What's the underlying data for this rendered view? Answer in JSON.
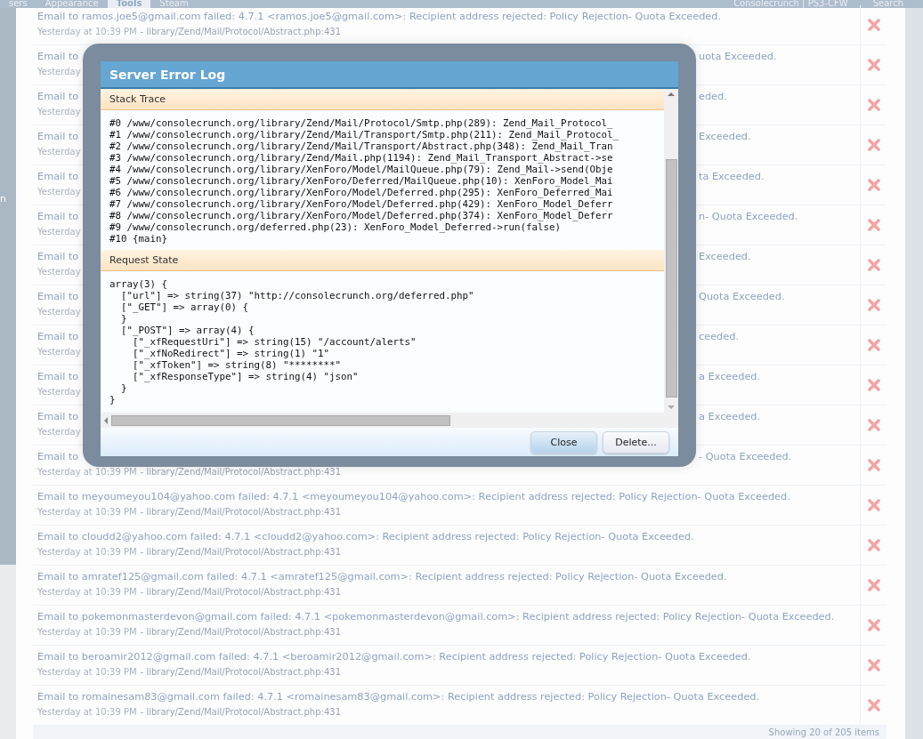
{
  "nav": {
    "tabs": [
      {
        "label": "sers",
        "selected": false
      },
      {
        "label": "Appearance",
        "selected": false
      },
      {
        "label": "Tools",
        "selected": true
      },
      {
        "label": "Steam",
        "selected": false
      }
    ],
    "links": [
      "Consolecrunch | PS3-CFW",
      "Search"
    ]
  },
  "sidebar": {
    "label": "n"
  },
  "rows": [
    {
      "kind": "full",
      "message": "Email to ramos.joe5@gmail.com failed: 4.7.1 <ramos.joe5@gmail.com>: Recipient address rejected: Policy Rejection- Quota Exceeded.",
      "time": "Yesterday at 10:39 PM",
      "source": "- library/Zend/Mail/Protocol/Abstract.php:431"
    },
    {
      "kind": "covered",
      "message_start": "Email to",
      "message_end": "uota Exceeded.",
      "time": "Yesterday"
    },
    {
      "kind": "covered",
      "message_start": "Email to",
      "message_end": "eded.",
      "time": "Yesterday"
    },
    {
      "kind": "covered",
      "message_start": "Email to",
      "message_end": "Exceeded.",
      "time": "Yesterday"
    },
    {
      "kind": "covered",
      "message_start": "Email to",
      "message_end": "ta Exceeded.",
      "time": "Yesterday"
    },
    {
      "kind": "covered",
      "message_start": "Email to",
      "message_end": "n- Quota Exceeded.",
      "time": "Yesterday"
    },
    {
      "kind": "covered",
      "message_start": "Email to",
      "message_end": "Exceeded.",
      "time": "Yesterday"
    },
    {
      "kind": "covered",
      "message_start": "Email to",
      "message_end": "Quota Exceeded.",
      "time": "Yesterday"
    },
    {
      "kind": "covered",
      "message_start": "Email to",
      "message_end": "ceeded.",
      "time": "Yesterday"
    },
    {
      "kind": "covered",
      "message_start": "Email to",
      "message_end": "a Exceeded.",
      "time": "Yesterday"
    },
    {
      "kind": "covered",
      "message_start": "Email to",
      "message_end": "a Exceeded.",
      "time": "Yesterday"
    },
    {
      "kind": "covered",
      "message_start": "Email to",
      "message_end": "- Quota Exceeded.",
      "time": "Yesterday at 10:39 PM",
      "source": "- library/Zend/Mail/Protocol/Abstract.php:431"
    },
    {
      "kind": "full",
      "message": "Email to meyoumeyou104@yahoo.com failed: 4.7.1 <meyoumeyou104@yahoo.com>: Recipient address rejected: Policy Rejection- Quota Exceeded.",
      "time": "Yesterday at 10:39 PM",
      "source": "- library/Zend/Mail/Protocol/Abstract.php:431"
    },
    {
      "kind": "full",
      "message": "Email to cloudd2@yahoo.com failed: 4.7.1 <cloudd2@yahoo.com>: Recipient address rejected: Policy Rejection- Quota Exceeded.",
      "time": "Yesterday at 10:39 PM",
      "source": "- library/Zend/Mail/Protocol/Abstract.php:431"
    },
    {
      "kind": "full",
      "message": "Email to amratef125@gmail.com failed: 4.7.1 <amratef125@gmail.com>: Recipient address rejected: Policy Rejection- Quota Exceeded.",
      "time": "Yesterday at 10:39 PM",
      "source": "- library/Zend/Mail/Protocol/Abstract.php:431"
    },
    {
      "kind": "full",
      "message": "Email to pokemonmasterdevon@gmail.com failed: 4.7.1 <pokemonmasterdevon@gmail.com>: Recipient address rejected: Policy Rejection- Quota Exceeded.",
      "time": "Yesterday at 10:39 PM",
      "source": "- library/Zend/Mail/Protocol/Abstract.php:431"
    },
    {
      "kind": "full",
      "message": "Email to beroamir2012@gmail.com failed: 4.7.1 <beroamir2012@gmail.com>: Recipient address rejected: Policy Rejection- Quota Exceeded.",
      "time": "Yesterday at 10:39 PM",
      "source": "- library/Zend/Mail/Protocol/Abstract.php:431"
    },
    {
      "kind": "full",
      "message": "Email to romainesam83@gmail.com failed: 4.7.1 <romainesam83@gmail.com>: Recipient address rejected: Policy Rejection- Quota Exceeded.",
      "time": "Yesterday at 10:39 PM",
      "source": "- library/Zend/Mail/Protocol/Abstract.php:431"
    }
  ],
  "footer": "Showing 20 of 205 items",
  "dialog": {
    "title": "Server Error Log",
    "sections": [
      {
        "heading": "Stack Trace",
        "lines": [
          "#0 /www/consolecrunch.org/library/Zend/Mail/Protocol/Smtp.php(289): Zend_Mail_Protocol_",
          "#1 /www/consolecrunch.org/library/Zend/Mail/Transport/Smtp.php(211): Zend_Mail_Protocol_",
          "#2 /www/consolecrunch.org/library/Zend/Mail/Transport/Abstract.php(348): Zend_Mail_Tran",
          "#3 /www/consolecrunch.org/library/Zend/Mail.php(1194): Zend_Mail_Transport_Abstract->se",
          "#4 /www/consolecrunch.org/library/XenForo/Model/MailQueue.php(79): Zend_Mail->send(Obje",
          "#5 /www/consolecrunch.org/library/XenForo/Deferred/MailQueue.php(10): XenForo_Model_Mai",
          "#6 /www/consolecrunch.org/library/XenForo/Model/Deferred.php(295): XenForo_Deferred_Mai",
          "#7 /www/consolecrunch.org/library/XenForo/Model/Deferred.php(429): XenForo_Model_Deferr",
          "#8 /www/consolecrunch.org/library/XenForo/Model/Deferred.php(374): XenForo_Model_Deferr",
          "#9 /www/consolecrunch.org/deferred.php(23): XenForo_Model_Deferred->run(false)",
          "#10 {main}"
        ]
      },
      {
        "heading": "Request State",
        "lines": [
          "array(3) {",
          "  [\"url\"] => string(37) \"http://consolecrunch.org/deferred.php\"",
          "  [\"_GET\"] => array(0) {",
          "  }",
          "  [\"_POST\"] => array(4) {",
          "    [\"_xfRequestUri\"] => string(15) \"/account/alerts\"",
          "    [\"_xfNoRedirect\"] => string(1) \"1\"",
          "    [\"_xfToken\"] => string(8) \"********\"",
          "    [\"_xfResponseType\"] => string(4) \"json\"",
          "  }",
          "}"
        ]
      }
    ],
    "buttons": [
      {
        "label": "Close",
        "kind": "primary"
      },
      {
        "label": "Delete...",
        "kind": "secondary"
      }
    ]
  }
}
